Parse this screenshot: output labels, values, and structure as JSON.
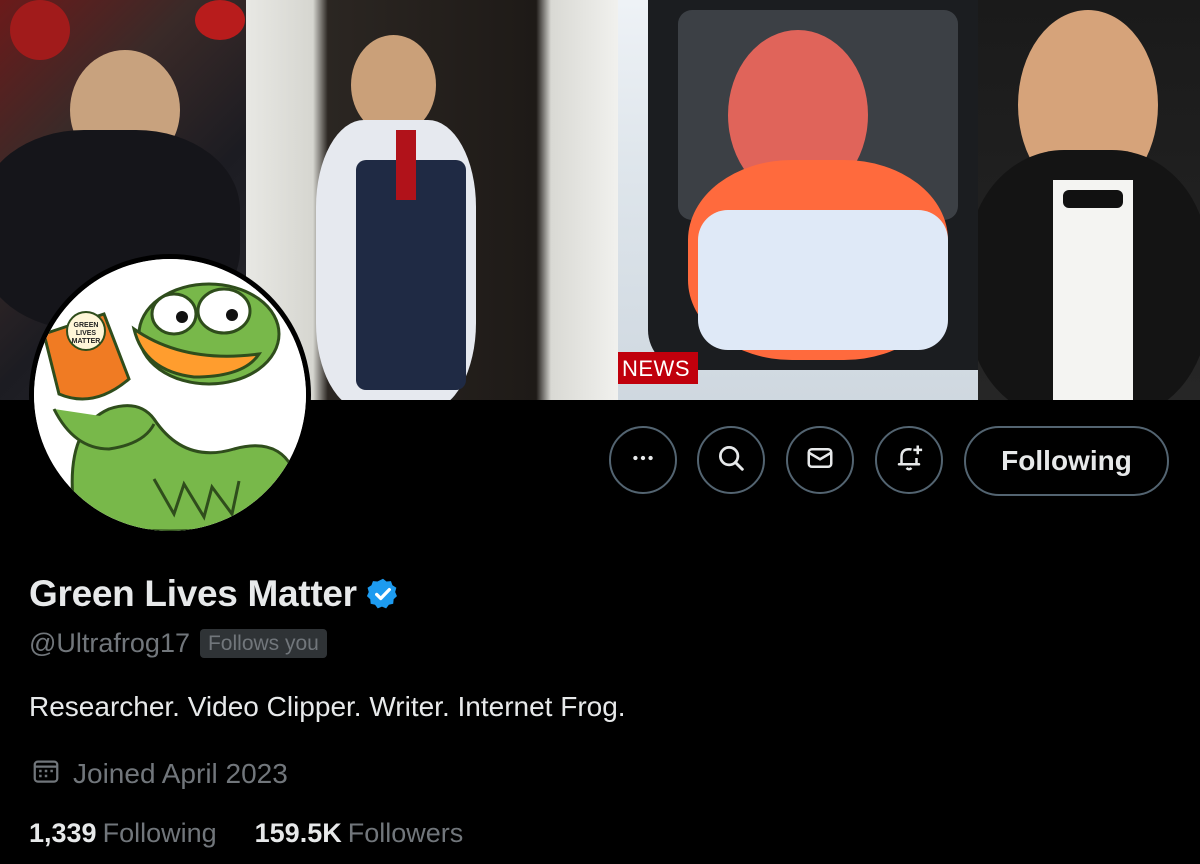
{
  "banner": {
    "news_tag": "NEWS"
  },
  "avatar": {
    "cup_text": "GREEN LIVES MATTER"
  },
  "actions": {
    "more_icon": "more-dots-icon",
    "search_icon": "search-icon",
    "message_icon": "envelope-icon",
    "notify_icon": "bell-plus-icon",
    "follow_label": "Following"
  },
  "profile": {
    "display_name": "Green Lives Matter",
    "verified": true,
    "handle": "@Ultrafrog17",
    "follows_you": "Follows you",
    "bio": "Researcher. Video Clipper. Writer. Internet Frog.",
    "joined": "Joined April 2023",
    "joined_icon": "calendar-icon"
  },
  "stats": {
    "following_count": "1,339",
    "following_label": "Following",
    "followers_count": "159.5K",
    "followers_label": "Followers"
  },
  "colors": {
    "background": "#000000",
    "primary_text": "#e7e9ea",
    "secondary_text": "#71767b",
    "border": "#536471",
    "verified_blue": "#1d9bf0"
  }
}
